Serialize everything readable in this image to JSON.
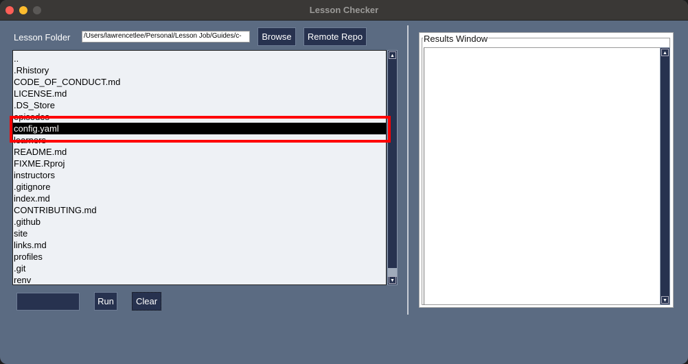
{
  "window": {
    "title": "Lesson Checker"
  },
  "folder": {
    "label": "Lesson Folder",
    "path": "/Users/lawrencetlee/Personal/Lesson Job/Guides/c-",
    "browse": "Browse",
    "remote": "Remote Repo"
  },
  "files": [
    "..",
    ".Rhistory",
    "CODE_OF_CONDUCT.md",
    "LICENSE.md",
    ".DS_Store",
    "episodes",
    "config.yaml",
    "learners",
    "README.md",
    "FIXME.Rproj",
    "instructors",
    ".gitignore",
    "index.md",
    "CONTRIBUTING.md",
    ".github",
    "site",
    "links.md",
    "profiles",
    ".git",
    "renv"
  ],
  "selected_file": "config.yaml",
  "controls": {
    "input_value": "",
    "run": "Run",
    "clear": "Clear"
  },
  "results": {
    "title": "Results Window",
    "content": ""
  },
  "colors": {
    "background": "#5b6b82",
    "button": "#27324f",
    "highlight": "#ff0000"
  }
}
